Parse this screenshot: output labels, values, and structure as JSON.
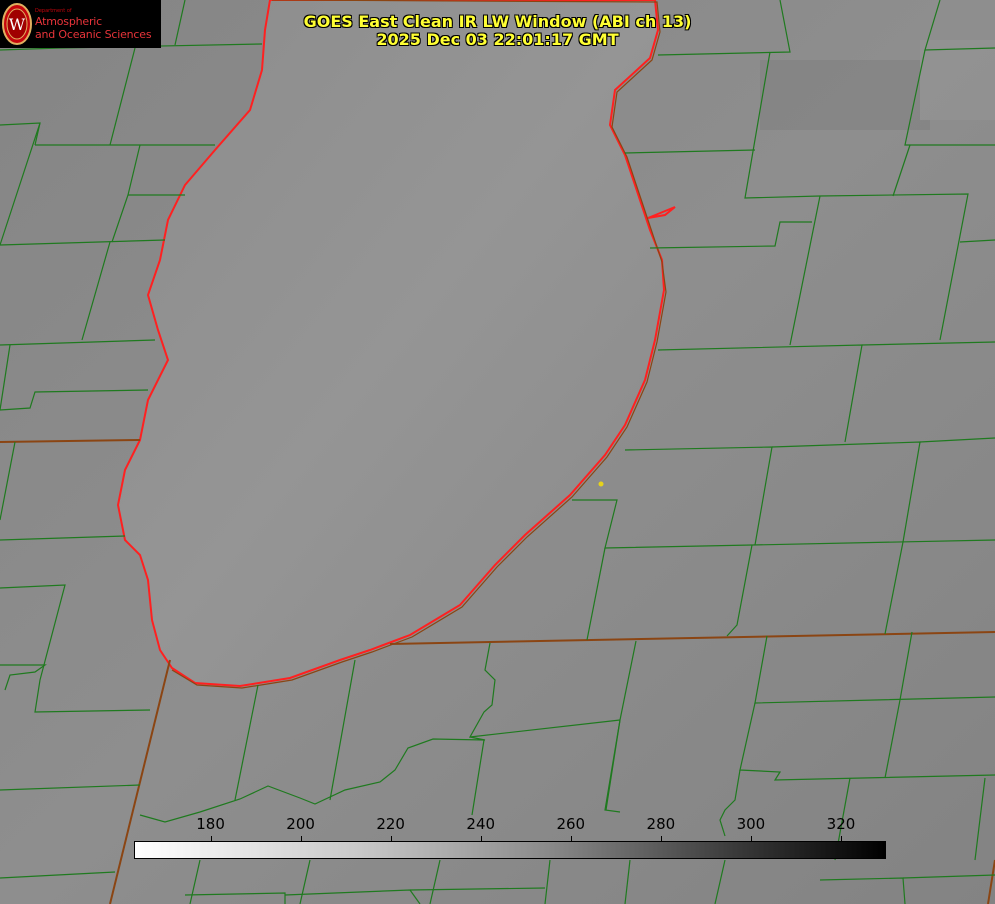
{
  "logo": {
    "dept": "Department of",
    "line1": "Atmospheric",
    "line2": "and Oceanic Sciences",
    "seal_letter": "W"
  },
  "title": {
    "line1": "GOES East Clean IR LW Window (ABI ch 13)",
    "line2": "2025 Dec 03 22:01:17 GMT"
  },
  "colorbar": {
    "ticks": [
      "180",
      "200",
      "220",
      "240",
      "260",
      "280",
      "300",
      "320"
    ],
    "min": 163,
    "max": 330,
    "colors": {
      "low": "#ffffff",
      "high": "#000000"
    }
  },
  "colors": {
    "county_lines": "#1f7a1f",
    "coastline": "#ff2020",
    "state_lines": "#8b4513",
    "marker": "#e6d21a",
    "title_text": "#ffff33"
  }
}
